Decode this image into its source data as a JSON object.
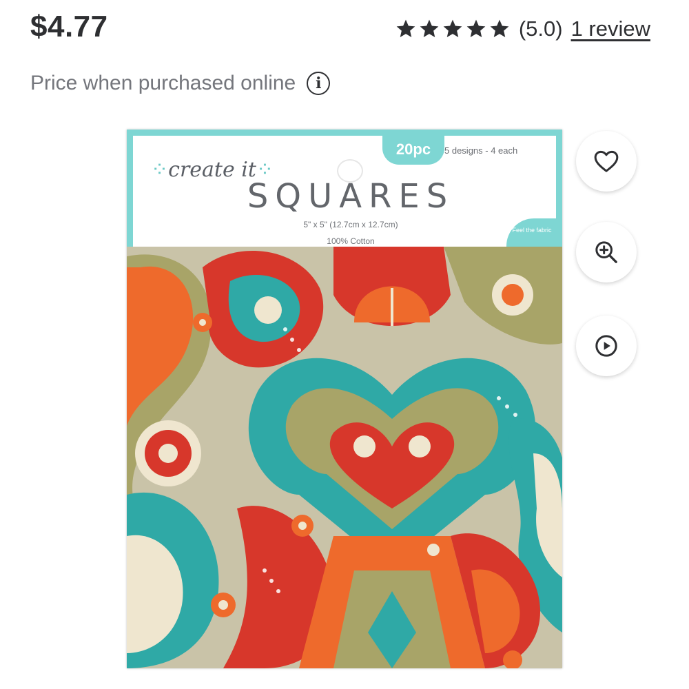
{
  "price": "$4.77",
  "rating": {
    "stars": 5,
    "score_text": "(5.0)",
    "review_link": "1 review",
    "star_icon": "star-icon"
  },
  "price_note": {
    "text": "Price when purchased online",
    "icon": "info-icon",
    "icon_glyph": "i"
  },
  "product_image": {
    "brand": "create it",
    "brand_sep": "∴",
    "badge": "20pc",
    "designs": "5 designs - 4 each",
    "title": "SQUARES",
    "dimensions": "5\" x 5\" (12.7cm x 12.7cm)",
    "material": "100% Cotton",
    "feel_tab": "Feel the fabric",
    "colors": {
      "teal": "#7ed6d3",
      "red": "#d7372b",
      "orange": "#ee6a2c",
      "olive": "#a8a468",
      "cream": "#efe6cf",
      "aqua": "#2fa9a6"
    }
  },
  "actions": [
    {
      "name": "favorite-button",
      "icon": "heart-icon"
    },
    {
      "name": "zoom-button",
      "icon": "zoom-in-icon"
    },
    {
      "name": "play-video-button",
      "icon": "play-icon"
    }
  ]
}
